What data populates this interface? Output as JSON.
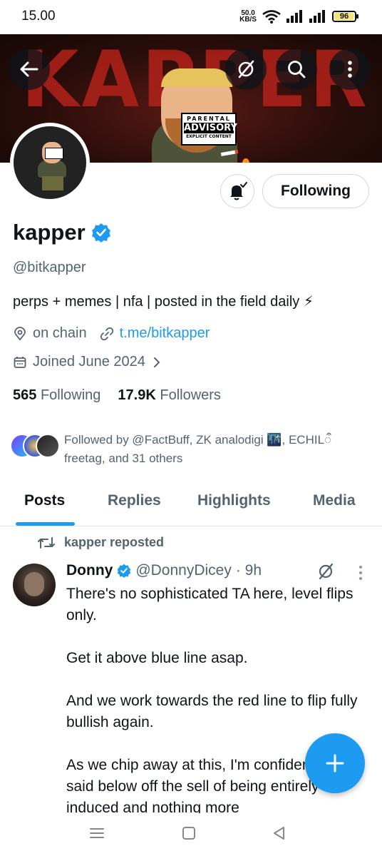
{
  "status_bar": {
    "time": "15.00",
    "net_speed_value": "50.0",
    "net_speed_unit": "KB/S",
    "battery": "96"
  },
  "banner": {
    "word": "KAPPER",
    "advisory_line1": "PARENTAL",
    "advisory_line2": "ADVISORY",
    "advisory_line3": "EXPLICIT CONTENT"
  },
  "profile": {
    "display_name": "kapper",
    "handle": "@bitkapper",
    "bio": "perps + memes | nfa | posted in the field daily ⚡",
    "location": "on chain",
    "link": "t.me/bitkapper",
    "joined": "Joined June 2024",
    "following_count": "565",
    "following_label": "Following",
    "followers_count": "17.9K",
    "followers_label": "Followers",
    "follow_button": "Following",
    "followed_by_line1": "Followed by @FactBuff, ZK analodigi 🌃, ECHILऀ",
    "followed_by_line2": "freetag, and 31 others"
  },
  "tabs": [
    "Posts",
    "Replies",
    "Highlights",
    "Media"
  ],
  "post": {
    "repost_label": "kapper reposted",
    "author": "Donny",
    "handle": "@DonnyDicey",
    "time": "· 9h",
    "paragraphs": [
      "There's no sophisticated TA here, level flips only.",
      "Get it above blue line asap.",
      "And we work towards the red line to flip fully bullish again.",
      "As we chip away at this, I'm confident what I said below off the sell of being entirely fear induced and nothing more"
    ]
  },
  "colors": {
    "accent": "#1d9bf0",
    "text_primary": "#0f1419",
    "text_secondary": "#536471"
  }
}
